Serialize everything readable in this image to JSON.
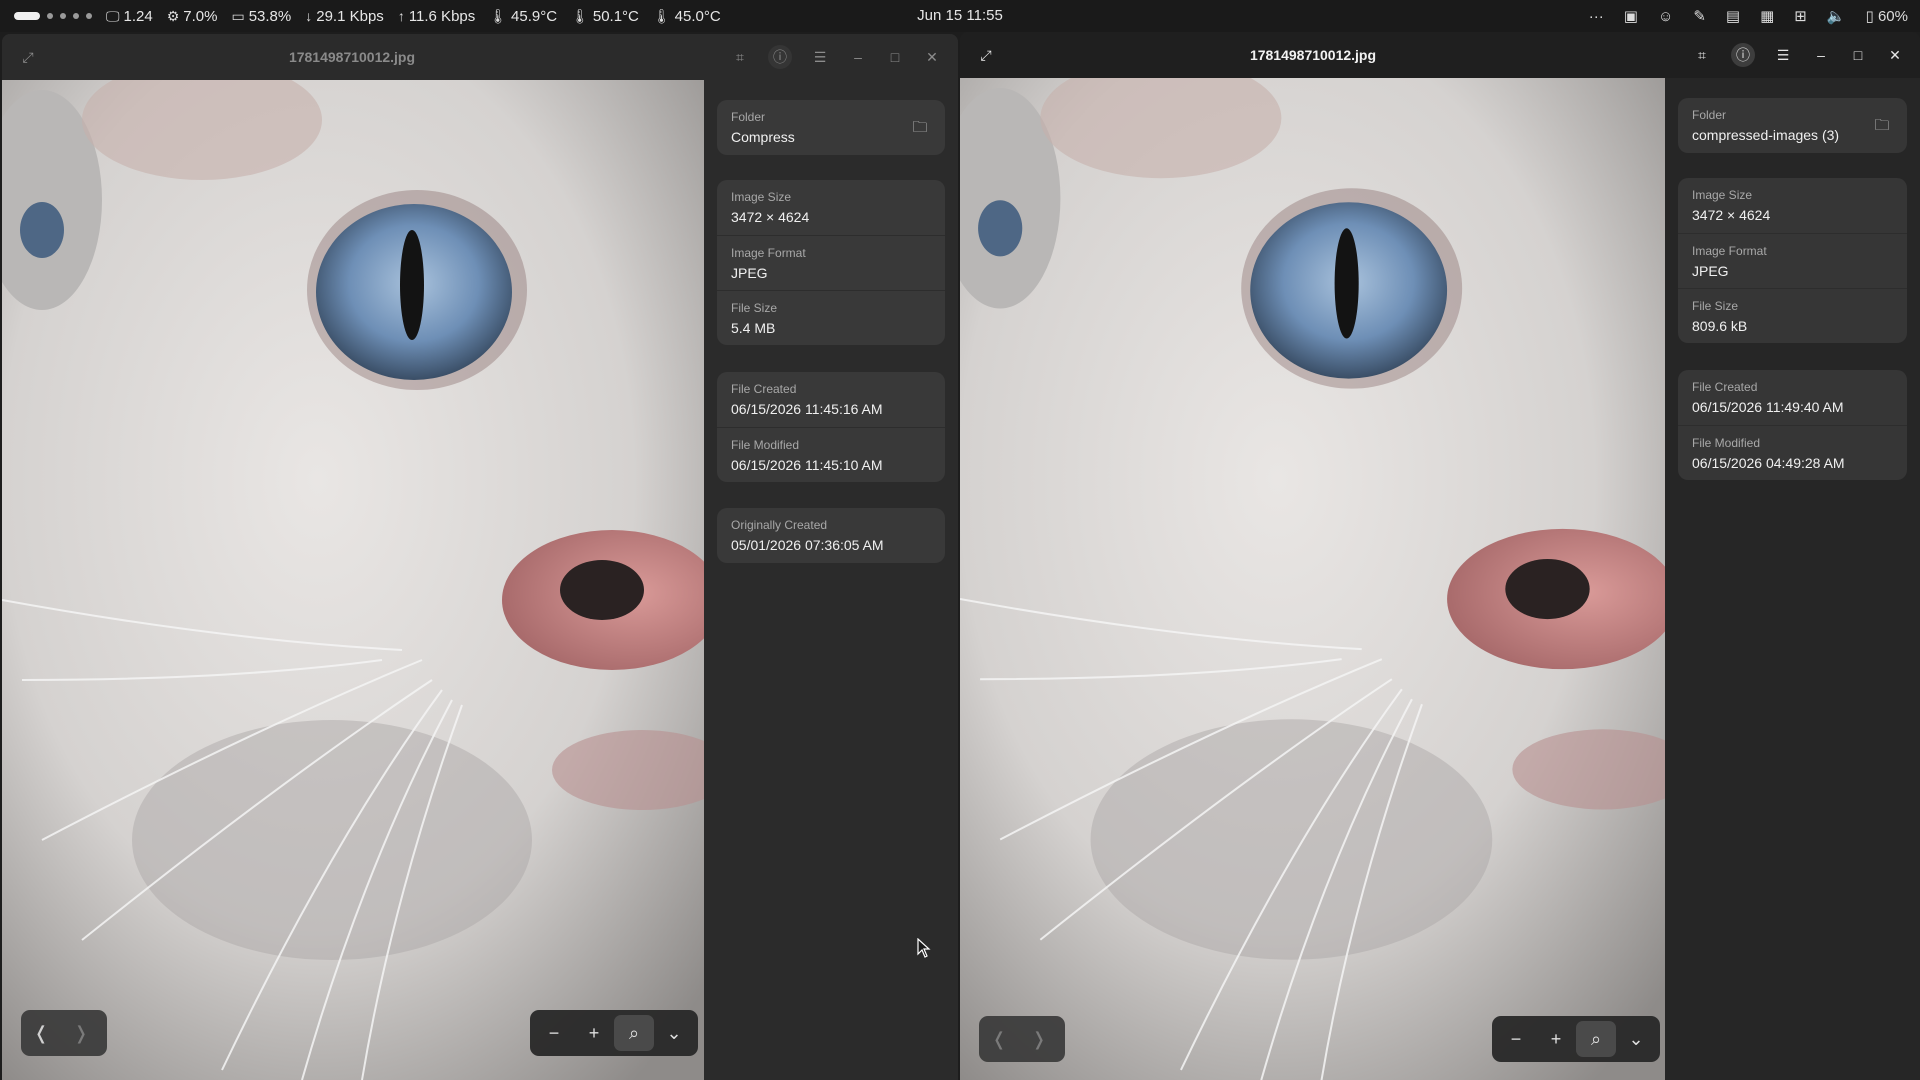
{
  "topbar": {
    "stats": [
      {
        "icon": "monitor-icon",
        "glyph": "🖵",
        "value": "1.24"
      },
      {
        "icon": "cpu-icon",
        "glyph": "⚙",
        "value": "7.0%"
      },
      {
        "icon": "memory-icon",
        "glyph": "▭",
        "value": "53.8%"
      },
      {
        "icon": "download-arrow-icon",
        "glyph": "↓",
        "value": "29.1 Kbps"
      },
      {
        "icon": "upload-arrow-icon",
        "glyph": "↑",
        "value": "11.6 Kbps"
      },
      {
        "icon": "thermometer-icon",
        "glyph": "🌡",
        "value": "45.9°C"
      },
      {
        "icon": "thermometer-icon",
        "glyph": "🌡",
        "value": "50.1°C"
      },
      {
        "icon": "thermometer-icon",
        "glyph": "🌡",
        "value": "45.0°C"
      }
    ],
    "clock": "Jun 15  11:55",
    "tray": {
      "more": "···",
      "battery": "60%"
    }
  },
  "left_window": {
    "title": "1781498710012.jpg",
    "folder_label": "Folder",
    "folder_value": "Compress",
    "image_size_label": "Image Size",
    "image_size_value": "3472 × 4624",
    "image_format_label": "Image Format",
    "image_format_value": "JPEG",
    "file_size_label": "File Size",
    "file_size_value": "5.4 MB",
    "file_created_label": "File Created",
    "file_created_value": "06/15/2026 11:45:16 AM",
    "file_modified_label": "File Modified",
    "file_modified_value": "06/15/2026 11:45:10 AM",
    "originally_created_label": "Originally Created",
    "originally_created_value": "05/01/2026 07:36:05 AM"
  },
  "right_window": {
    "title": "1781498710012.jpg",
    "folder_label": "Folder",
    "folder_value": "compressed-images (3)",
    "image_size_label": "Image Size",
    "image_size_value": "3472 × 4624",
    "image_format_label": "Image Format",
    "image_format_value": "JPEG",
    "file_size_label": "File Size",
    "file_size_value": "809.6 kB",
    "file_created_label": "File Created",
    "file_created_value": "06/15/2026 11:49:40 AM",
    "file_modified_label": "File Modified",
    "file_modified_value": "06/15/2026 04:49:28 AM"
  },
  "colors": {
    "panel_bg": "#2b2b2b",
    "card_bg": "#393939",
    "eye_blue": "#6f8fb5",
    "nose_pink": "#c9898a"
  }
}
